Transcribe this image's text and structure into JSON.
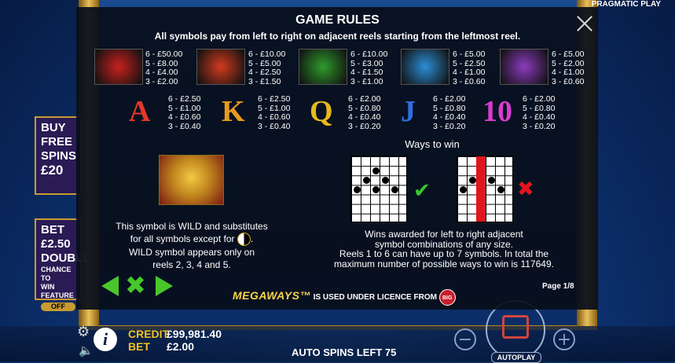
{
  "brand": "PRAGMATIC PLAY",
  "left_promo": {
    "buy_lines": [
      "BUY",
      "FREE",
      "SPINS"
    ],
    "buy_price": "£20",
    "bet_label": "BET",
    "bet_value": "£2.50",
    "double_label": "DOUBLE",
    "chance_lines": [
      "CHANCE TO",
      "WIN FEATURE"
    ],
    "toggle_label": "OFF"
  },
  "rules": {
    "title": "GAME RULES",
    "subtitle": "All symbols pay from left to right on adjacent reels starting from the leftmost reel.",
    "premium": [
      {
        "icon": "dragon-symbol-icon",
        "pays": "6 - £50.00\n5 - £8.00\n4 - £4.00\n3 - £2.00",
        "color": "#c8211f"
      },
      {
        "icon": "phoenix-symbol-icon",
        "pays": "6 - £10.00\n5 - £5.00\n4 - £2.50\n3 - £1.50",
        "color": "#d23a1e"
      },
      {
        "icon": "toad-symbol-icon",
        "pays": "6 - £10.00\n5 - £3.00\n4 - £1.50\n3 - £1.00",
        "color": "#2f9a2b"
      },
      {
        "icon": "koi-fish-symbol-icon",
        "pays": "6 - £5.00\n5 - £2.50\n4 - £1.00\n3 - £0.60",
        "color": "#2b8fd6"
      },
      {
        "icon": "turtle-symbol-icon",
        "pays": "6 - £5.00\n5 - £2.00\n4 - £1.00\n3 - £0.60",
        "color": "#8b3bbf"
      }
    ],
    "low": [
      {
        "letter": "A",
        "color": "#e3382a",
        "pays": "6 - £2.50\n5 - £1.00\n4 - £0.60\n3 - £0.40"
      },
      {
        "letter": "K",
        "color": "#e69a1f",
        "pays": "6 - £2.50\n5 - £1.00\n4 - £0.60\n3 - £0.40"
      },
      {
        "letter": "Q",
        "color": "#e8b81c",
        "pays": "6 - £2.00\n5 - £0.80\n4 - £0.40\n3 - £0.20"
      },
      {
        "letter": "J",
        "color": "#2f6ee0",
        "pays": "6 - £2.00\n5 - £0.80\n4 - £0.40\n3 - £0.20"
      },
      {
        "letter": "10",
        "color": "#d93bd0",
        "pays": "6 - £2.00\n5 - £0.80\n4 - £0.40\n3 - £0.20"
      }
    ],
    "wild_text": {
      "line1": "This symbol is WILD and substitutes",
      "line2_pre": "for all symbols except for",
      "line2_post": ".",
      "line3": "WILD symbol appears only on",
      "line4": "reels 2, 3, 4 and 5."
    },
    "ways_title": "Ways to win",
    "ways_text": {
      "line1": "Wins awarded for left to right adjacent",
      "line2": "symbol combinations of any size.",
      "line3": "Reels 1 to 6 can have up to 7 symbols. In total the",
      "line4": "maximum number of possible ways to win is 117649."
    },
    "page": "Page 1/8",
    "licence": {
      "mark": "MEGAWAYS™",
      "text": "IS USED UNDER LICENCE FROM",
      "badge": "BIG"
    }
  },
  "bottom": {
    "credit_label": "CREDIT",
    "credit_value": "£99,981.40",
    "bet_label": "BET",
    "bet_value": "£2.00",
    "auto_spins": "AUTO SPINS LEFT 75",
    "autoplay_label": "AUTOPLAY"
  }
}
